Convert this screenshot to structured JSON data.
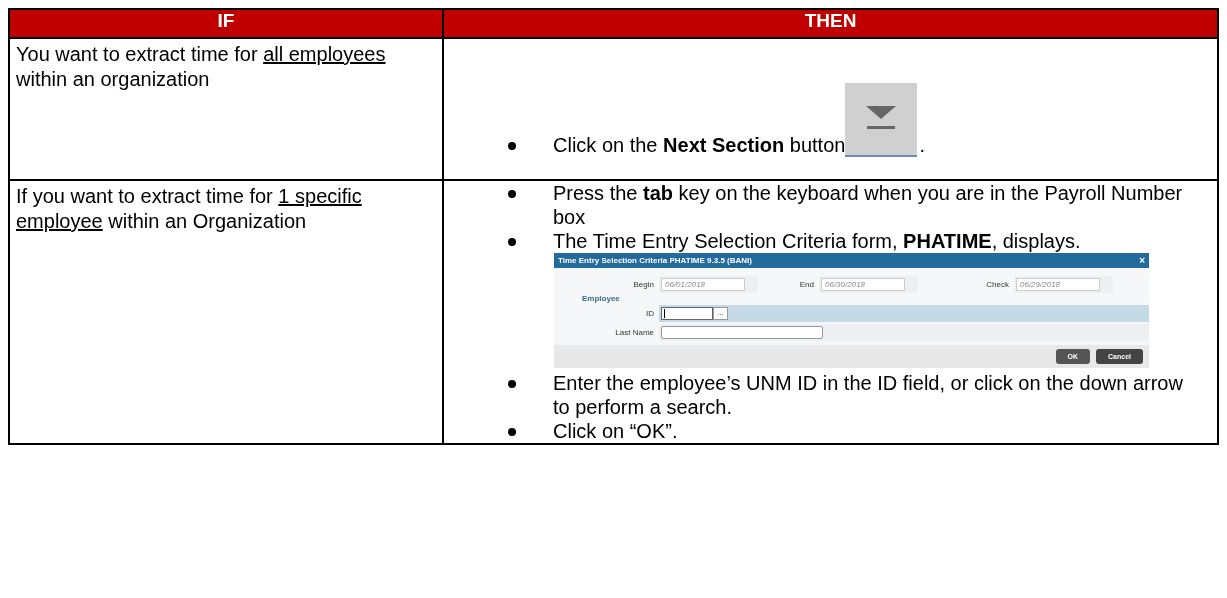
{
  "table": {
    "columns": [
      "IF",
      "THEN"
    ],
    "rows": [
      {
        "condition": [
          {
            "text": "You want to extract time for "
          },
          {
            "text": "all employees",
            "underline": true
          },
          {
            "text": " within an organization"
          }
        ],
        "steps": [
          {
            "kind": "button",
            "text": "Click on the **Next Section** button",
            "after": "."
          }
        ]
      },
      {
        "condition": [
          {
            "text": "If you want to extract time for "
          },
          {
            "text": "1 specific employee",
            "underline": true
          },
          {
            "text": " within an Organization"
          }
        ],
        "steps": [
          {
            "kind": "text",
            "text": "Press the **tab** key on the keyboard when you are in the Payroll Number box"
          },
          {
            "kind": "dialog",
            "text": "The Time Entry Selection Criteria form, **PHATIME**, displays."
          },
          {
            "kind": "text",
            "text": "Enter the employee’s UNM ID in the ID field, or click on the down arrow to perform a search."
          },
          {
            "kind": "text",
            "text": "Click on “OK”."
          }
        ]
      }
    ]
  },
  "dialog": {
    "title": "Time Entry Selection Criteria PHATIME 9.3.5 (BANI)",
    "close": "×",
    "dates": [
      {
        "label": "Begin",
        "value": "06/01/2018"
      },
      {
        "label": "End",
        "value": "06/30/2018"
      },
      {
        "label": "Check",
        "value": "06/29/2018"
      }
    ],
    "section": "Employee",
    "id_label": "ID",
    "lookup": "...",
    "name_label": "Last Name",
    "buttons": [
      {
        "label": "OK",
        "kind": "primary"
      },
      {
        "label": "Cancel",
        "kind": "secondary"
      }
    ]
  }
}
